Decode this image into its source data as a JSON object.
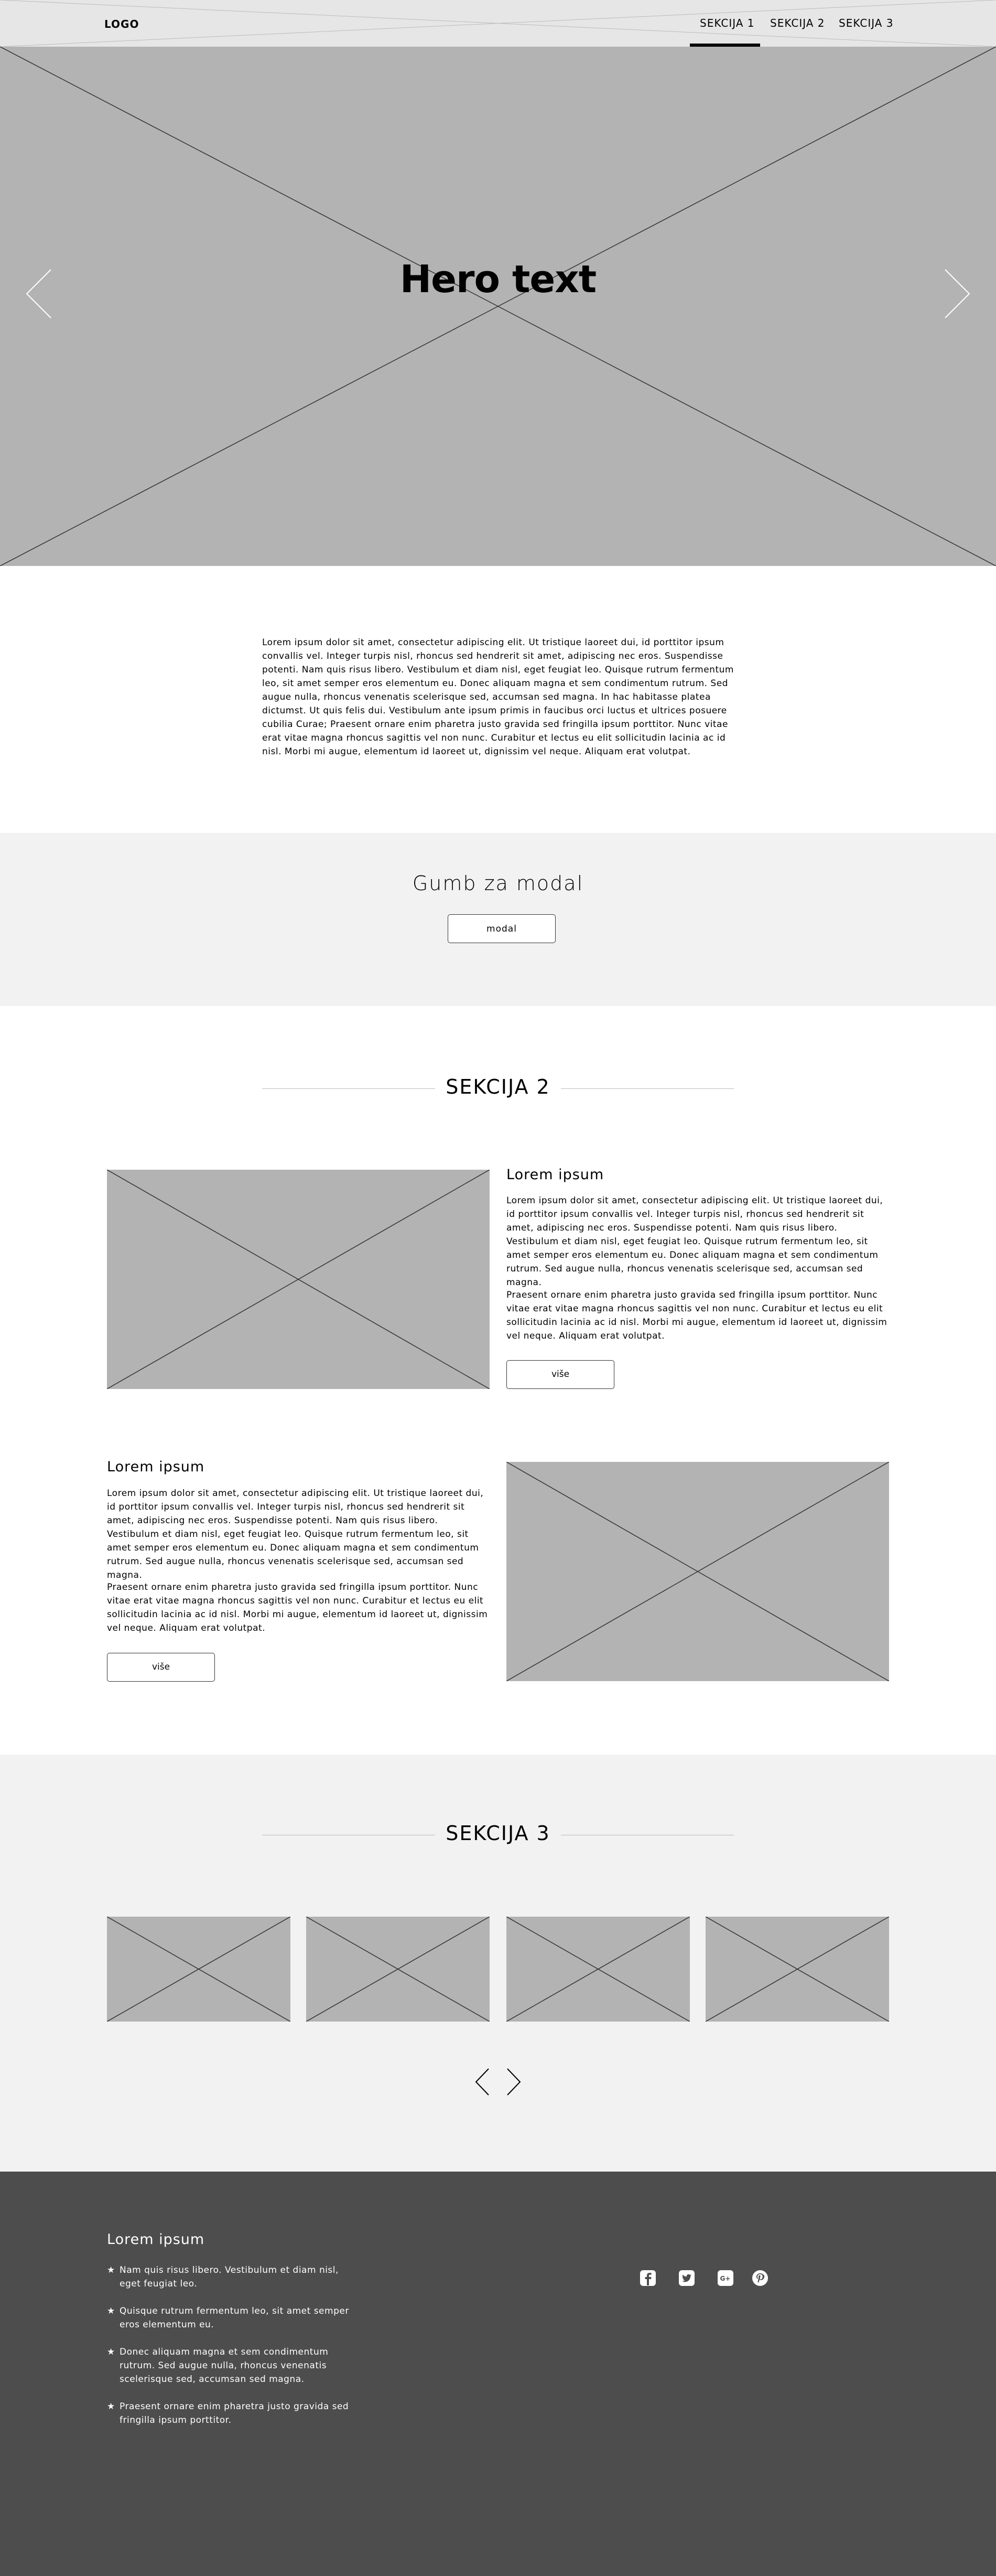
{
  "header": {
    "logo": "LOGO",
    "nav": [
      "SEKCIJA 1",
      "SEKCIJA 2",
      "SEKCIJA 3"
    ],
    "active_index": 0
  },
  "hero": {
    "text": "Hero text",
    "prev_icon": "chevron-left-icon",
    "next_icon": "chevron-right-icon"
  },
  "intro": {
    "text": "Lorem ipsum dolor sit amet, consectetur adipiscing elit. Ut tristique laoreet dui, id porttitor ipsum convallis vel. Integer turpis nisl, rhoncus sed hendrerit sit amet, adipiscing nec eros. Suspendisse potenti. Nam quis risus libero. Vestibulum et diam nisl, eget feugiat leo. Quisque rutrum fermentum leo, sit amet semper eros elementum eu. Donec aliquam magna et sem condimentum rutrum. Sed augue nulla, rhoncus venenatis scelerisque sed, accumsan sed magna. In hac habitasse platea dictumst. Ut quis felis dui. Vestibulum ante ipsum primis in faucibus orci luctus et ultrices posuere cubilia Curae; Praesent ornare enim pharetra justo gravida sed fringilla ipsum porttitor. Nunc vitae erat vitae magna rhoncus sagittis vel non nunc. Curabitur et lectus eu elit sollicitudin lacinia ac id nisl. Morbi mi augue, elementum id laoreet ut, dignissim vel neque. Aliquam erat volutpat."
  },
  "modal_section": {
    "title": "Gumb za modal",
    "button": "modal"
  },
  "sekcija2": {
    "title": "SEKCIJA 2",
    "blocks": [
      {
        "heading": "Lorem ipsum",
        "p1": "Lorem ipsum dolor sit amet, consectetur adipiscing elit. Ut tristique laoreet dui, id porttitor ipsum convallis vel. Integer turpis nisl, rhoncus sed hendrerit sit amet, adipiscing nec eros. Suspendisse potenti. Nam quis risus libero. Vestibulum et diam nisl, eget feugiat leo. Quisque rutrum fermentum leo, sit amet semper eros elementum eu. Donec aliquam magna et sem condimentum rutrum. Sed augue nulla, rhoncus venenatis scelerisque sed, accumsan sed magna.",
        "p2": "Praesent ornare enim pharetra justo gravida sed fringilla ipsum porttitor. Nunc vitae erat vitae magna rhoncus sagittis vel non nunc. Curabitur et lectus eu elit sollicitudin lacinia ac id nisl. Morbi mi augue, elementum id laoreet ut, dignissim vel neque. Aliquam erat volutpat.",
        "button": "više"
      },
      {
        "heading": "Lorem ipsum",
        "p1": "Lorem ipsum dolor sit amet, consectetur adipiscing elit. Ut tristique laoreet dui, id porttitor ipsum convallis vel. Integer turpis nisl, rhoncus sed hendrerit sit amet, adipiscing nec eros. Suspendisse potenti. Nam quis risus libero. Vestibulum et diam nisl, eget feugiat leo. Quisque rutrum fermentum leo, sit amet semper eros elementum eu. Donec aliquam magna et sem condimentum rutrum. Sed augue nulla, rhoncus venenatis scelerisque sed, accumsan sed magna.",
        "p2": "Praesent ornare enim pharetra justo gravida sed fringilla ipsum porttitor. Nunc vitae erat vitae magna rhoncus sagittis vel non nunc. Curabitur et lectus eu elit sollicitudin lacinia ac id nisl. Morbi mi augue, elementum id laoreet ut, dignissim vel neque. Aliquam erat volutpat.",
        "button": "više"
      }
    ]
  },
  "sekcija3": {
    "title": "SEKCIJA 3",
    "prev_icon": "chevron-left-icon",
    "next_icon": "chevron-right-icon"
  },
  "footer": {
    "title": "Lorem ipsum",
    "items": [
      "Nam quis risus libero. Vestibulum et diam nisl, eget feugiat leo.",
      "Quisque rutrum fermentum leo, sit amet semper eros elementum eu.",
      "Donec aliquam magna et sem condimentum rutrum. Sed augue nulla, rhoncus venenatis scelerisque sed, accumsan sed magna.",
      "Praesent ornare enim pharetra justo gravida sed fringilla ipsum porttitor."
    ],
    "social": [
      "facebook-icon",
      "twitter-icon",
      "google-plus-icon",
      "pinterest-icon"
    ]
  }
}
